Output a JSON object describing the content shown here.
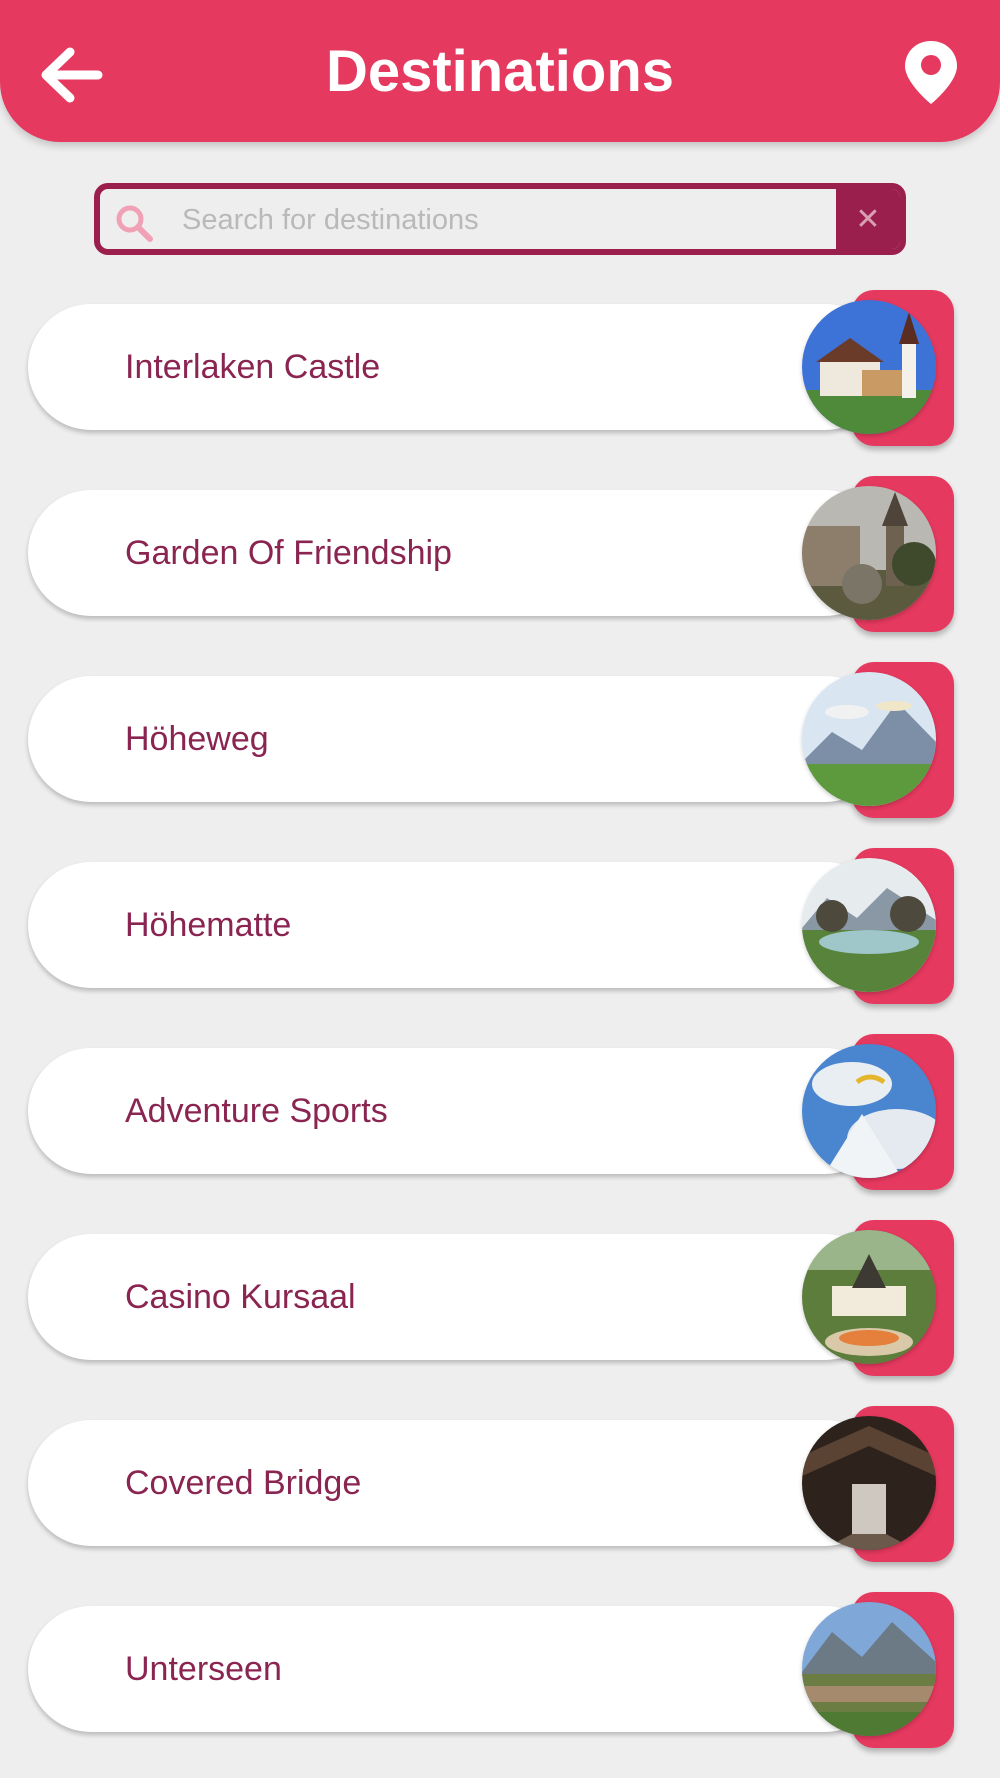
{
  "header": {
    "title": "Destinations",
    "back_icon": "arrow-left-icon",
    "location_icon": "map-pin-icon"
  },
  "search": {
    "placeholder": "Search for destinations",
    "value": "",
    "clear_label": "✕"
  },
  "colors": {
    "accent": "#e5395f",
    "dark_accent": "#9b1f4c",
    "label": "#8a2450",
    "background": "#efeeee"
  },
  "destinations": [
    {
      "name": "Interlaken Castle"
    },
    {
      "name": "Garden Of Friendship"
    },
    {
      "name": "Höheweg"
    },
    {
      "name": "Höhematte"
    },
    {
      "name": "Adventure Sports"
    },
    {
      "name": "Casino Kursaal"
    },
    {
      "name": "Covered Bridge"
    },
    {
      "name": "Unterseen"
    }
  ]
}
